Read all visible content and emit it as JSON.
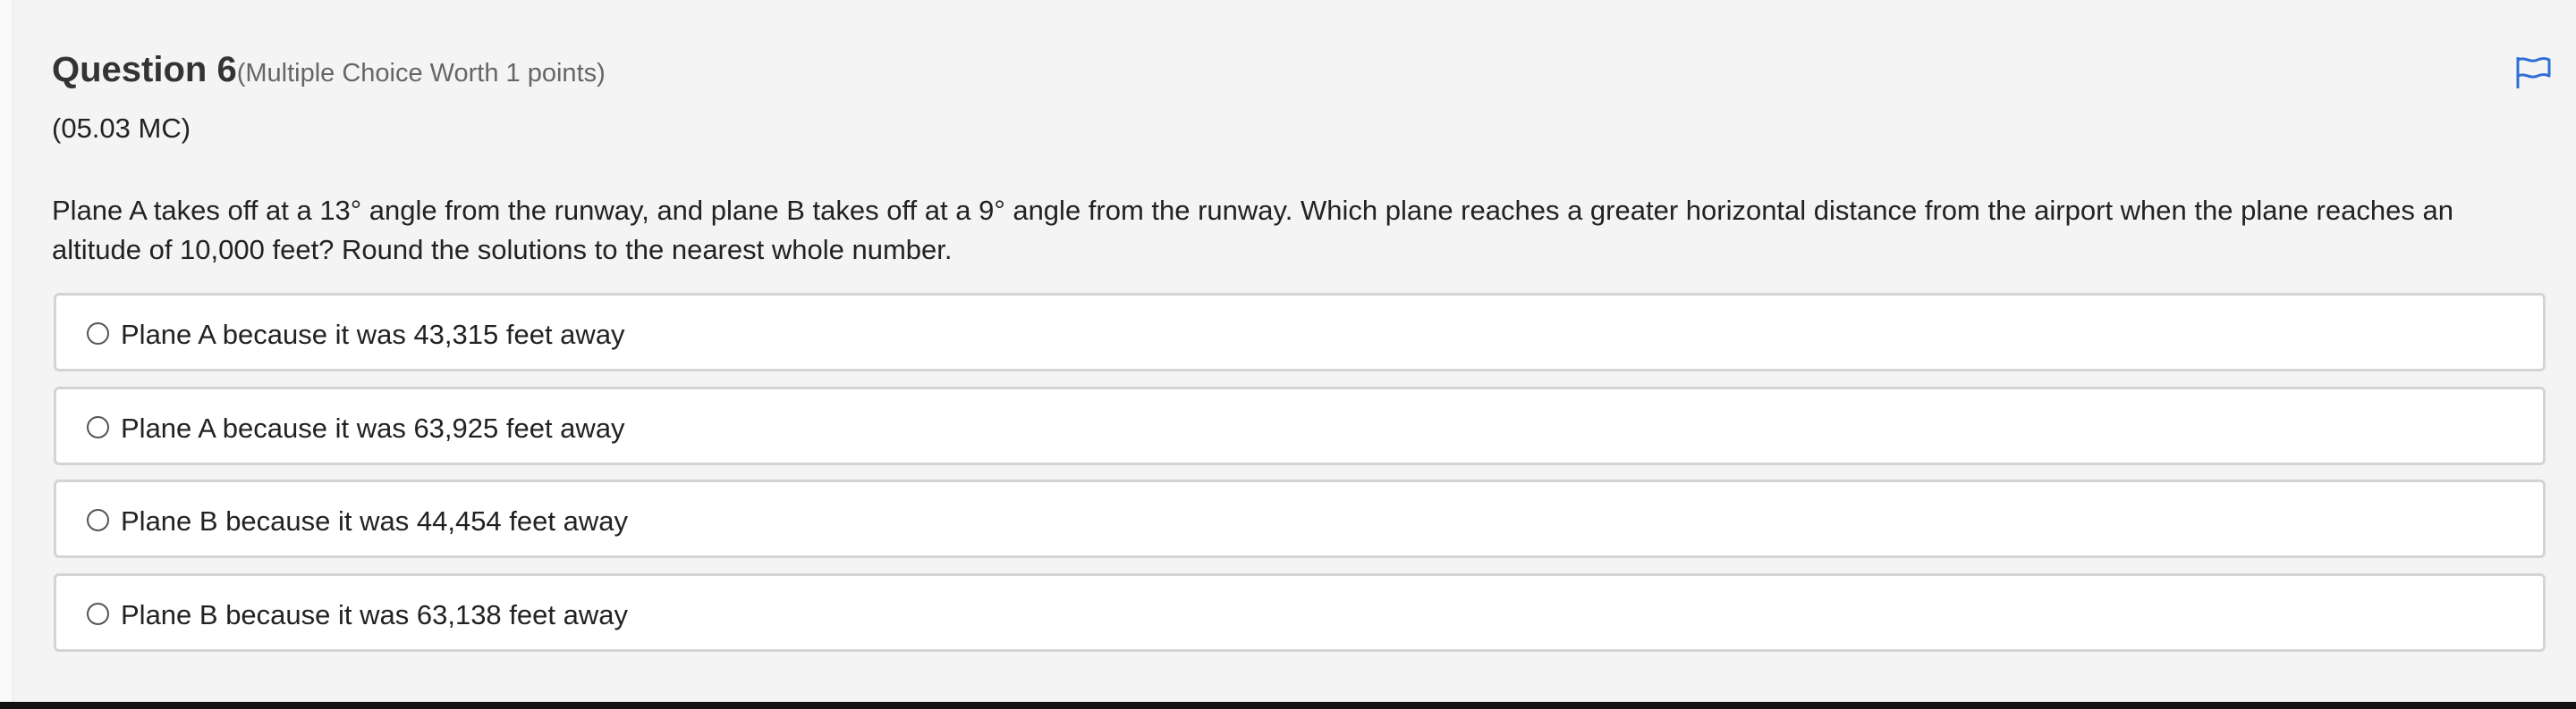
{
  "question": {
    "title": "Question 6",
    "meta": "(Multiple Choice Worth 1 points)",
    "code": "(05.03 MC)",
    "text": "Plane A takes off at a 13° angle from the runway, and plane B takes off at a 9° angle from the runway. Which plane reaches a greater horizontal distance from the airport when the plane reaches an altitude of 10,000 feet? Round the solutions to the nearest whole number.",
    "flag_icon": "flag-icon",
    "choices": [
      {
        "label": "Plane A because it was 43,315 feet away",
        "selected": false
      },
      {
        "label": "Plane A because it was 63,925 feet away",
        "selected": false
      },
      {
        "label": "Plane B because it was 44,454 feet away",
        "selected": false
      },
      {
        "label": "Plane B because it was 63,138 feet away",
        "selected": false
      }
    ]
  },
  "colors": {
    "accent": "#2f6fd6",
    "choice_border": "#d4d4d4",
    "background": "#f4f4f4"
  }
}
